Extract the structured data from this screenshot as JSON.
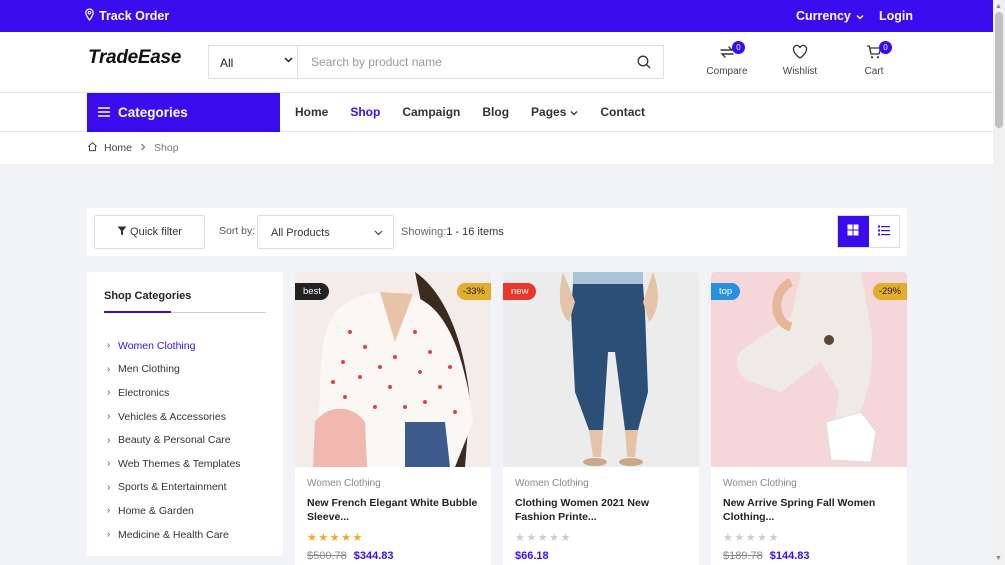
{
  "topbar": {
    "track_order": "Track Order",
    "currency": "Currency",
    "login": "Login"
  },
  "header": {
    "logo": "TradeEase",
    "category_select": "All",
    "search_placeholder": "Search by product name",
    "compare": {
      "label": "Compare",
      "count": "0"
    },
    "wishlist": {
      "label": "Wishlist"
    },
    "cart": {
      "label": "Cart",
      "count": "0"
    }
  },
  "nav": {
    "categories_label": "Categories",
    "links": [
      "Home",
      "Shop",
      "Campaign",
      "Blog",
      "Pages",
      "Contact"
    ],
    "active": "Shop"
  },
  "breadcrumb": {
    "home": "Home",
    "current": "Shop"
  },
  "toolbar": {
    "quick_filter": "Quick filter",
    "sort_label": "Sort by:",
    "sort_value": "All Products",
    "showing_label": "Showing:",
    "showing_range": "1 - 16 items"
  },
  "sidebar": {
    "title": "Shop Categories",
    "items": [
      "Women Clothing",
      "Men Clothing",
      "Electronics",
      "Vehicles & Accessories",
      "Beauty & Personal Care",
      "Web Themes & Templates",
      "Sports & Entertainment",
      "Home & Garden",
      "Medicine & Health Care"
    ],
    "active": "Women Clothing"
  },
  "products": [
    {
      "tag": "best",
      "tag_color": "#222222",
      "discount": "-33%",
      "category": "Women Clothing",
      "name": "New French Elegant White Bubble Sleeve...",
      "rating": 5,
      "old_price": "$500.78",
      "price": "$344.83"
    },
    {
      "tag": "new",
      "tag_color": "#e8372b",
      "discount": "",
      "category": "Women Clothing",
      "name": "Clothing Women 2021 New Fashion Printe...",
      "rating": 0,
      "old_price": "",
      "price": "$66.18"
    },
    {
      "tag": "top",
      "tag_color": "#2a8fe0",
      "discount": "-29%",
      "category": "Women Clothing",
      "name": "New Arrive Spring Fall Women Clothing...",
      "rating": 0,
      "old_price": "$189.78",
      "price": "$144.83"
    }
  ],
  "colors": {
    "brand": "#3a0ced",
    "star_filled": "#f5a623",
    "star_empty": "#cccccc",
    "discount_badge": "#e2ac2c"
  }
}
